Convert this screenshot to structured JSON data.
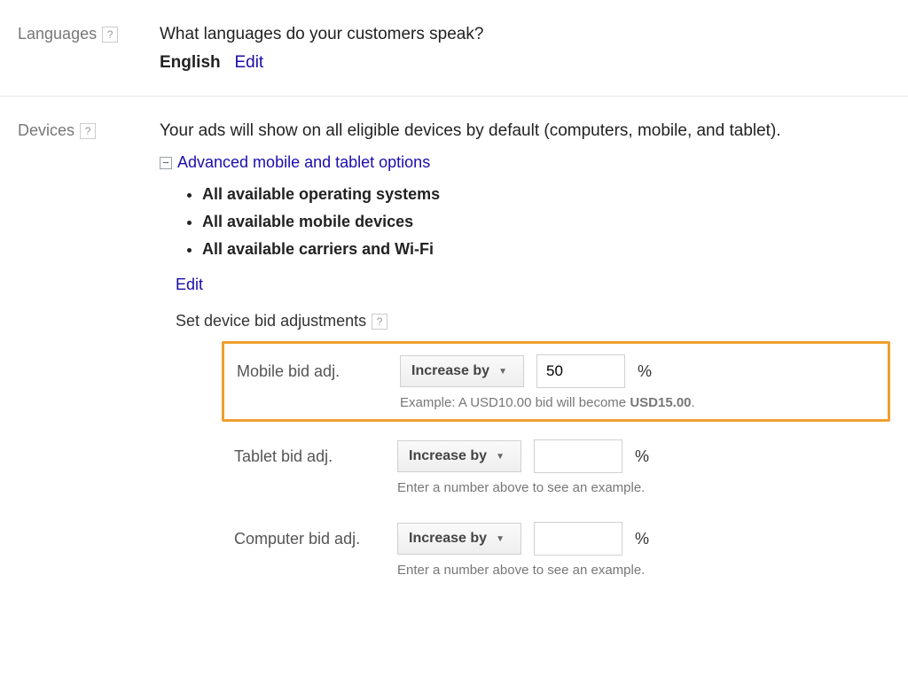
{
  "languages": {
    "label": "Languages",
    "heading": "What languages do your customers speak?",
    "value": "English",
    "edit_label": "Edit"
  },
  "devices": {
    "label": "Devices",
    "heading": "Your ads will show on all eligible devices by default (computers, mobile, and tablet).",
    "expander_label": "Advanced mobile and tablet options",
    "expander_symbol": "−",
    "options": [
      "All available operating systems",
      "All available mobile devices",
      "All available carriers and Wi-Fi"
    ],
    "edit_label": "Edit",
    "subheading": "Set device bid adjustments",
    "bid_rows": {
      "mobile": {
        "label": "Mobile bid adj.",
        "direction": "Increase by",
        "value": "50",
        "percent": "%",
        "hint_prefix": "Example: A USD10.00 bid will become ",
        "hint_strong": "USD15.00",
        "hint_suffix": "."
      },
      "tablet": {
        "label": "Tablet bid adj.",
        "direction": "Increase by",
        "value": "",
        "percent": "%",
        "hint": "Enter a number above to see an example."
      },
      "computer": {
        "label": "Computer bid adj.",
        "direction": "Increase by",
        "value": "",
        "percent": "%",
        "hint": "Enter a number above to see an example."
      }
    }
  },
  "help_glyph": "?"
}
